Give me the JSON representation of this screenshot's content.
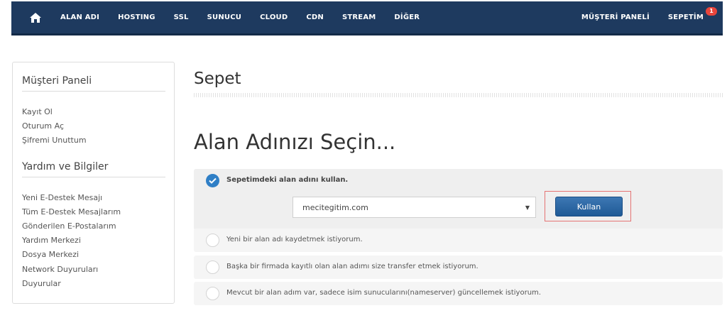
{
  "nav": {
    "items": [
      "ALAN ADI",
      "HOSTING",
      "SSL",
      "SUNUCU",
      "CLOUD",
      "CDN",
      "STREAM",
      "DİĞER"
    ],
    "customer_panel": "MÜŞTERİ PANELİ",
    "cart": "SEPETİM",
    "cart_count": "1"
  },
  "sidebar": {
    "customer_panel_heading": "Müşteri Paneli",
    "customer_links": [
      "Kayıt Ol",
      "Oturum Aç",
      "Şifremi Unuttum"
    ],
    "help_heading": "Yardım ve Bilgiler",
    "help_links": [
      "Yeni E-Destek Mesajı",
      "Tüm E-Destek Mesajlarım",
      "Gönderilen E-Postalarım",
      "Yardım Merkezi",
      "Dosya Merkezi",
      "Network Duyuruları",
      "Duyurular"
    ]
  },
  "main": {
    "page_title": "Sepet",
    "section_title": "Alan Adınızı Seçin...",
    "selected_option": {
      "label": "Sepetimdeki alan adını kullan.",
      "domain_value": "mecitegitim.com",
      "button_label": "Kullan"
    },
    "options": [
      "Yeni bir alan adı kaydetmek istiyorum.",
      "Başka bir firmada kayıtlı olan alan adımı size transfer etmek istiyorum.",
      "Mevcut bir alan adım var, sadece isim sunucularını(nameserver) güncellemek istiyorum."
    ]
  },
  "colors": {
    "navbar": "#1e3a5f",
    "accent": "#2f7fc6",
    "badge": "#e8453c",
    "highlight": "#e57373"
  }
}
